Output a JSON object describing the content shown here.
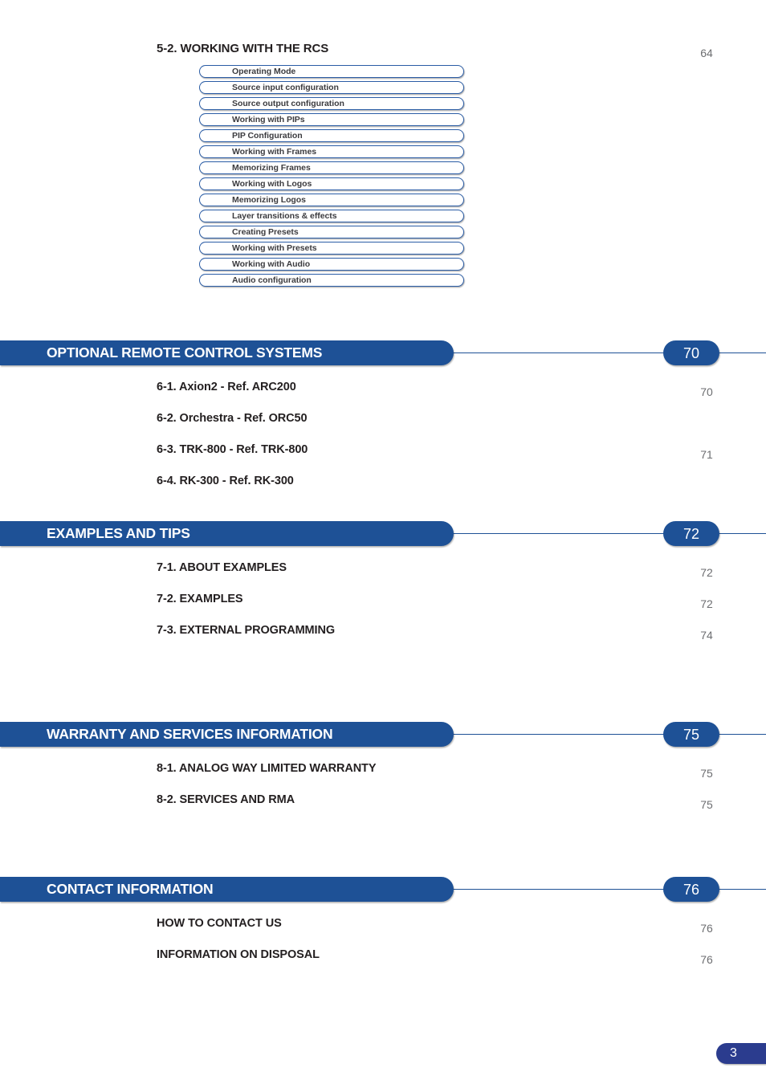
{
  "document": {
    "page_label": "3"
  },
  "top_section": {
    "heading": "5-2. WORKING WITH THE RCS",
    "page": "64",
    "pills": [
      {
        "label": "Operating Mode"
      },
      {
        "label": "Source input configuration"
      },
      {
        "label": "Source output configuration"
      },
      {
        "label": "Working with PIPs"
      },
      {
        "label": "PIP Configuration"
      },
      {
        "label": "Working with Frames"
      },
      {
        "label": "Memorizing Frames"
      },
      {
        "label": "Working with Logos"
      },
      {
        "label": "Memorizing Logos"
      },
      {
        "label": "Layer transitions & effects"
      },
      {
        "label": "Creating Presets"
      },
      {
        "label": "Working with Presets"
      },
      {
        "label": "Working with Audio"
      },
      {
        "label": "Audio configuration"
      }
    ]
  },
  "sections": [
    {
      "title": "OPTIONAL REMOTE CONTROL SYSTEMS",
      "page": "70",
      "entries": [
        {
          "label": "6-1. Axion2 - Ref. ARC200",
          "page": "70"
        },
        {
          "label": "6-2. Orchestra - Ref. ORC50",
          "page": ""
        },
        {
          "label": "6-3. TRK-800 - Ref. TRK-800",
          "page": "71"
        },
        {
          "label": "6-4. RK-300 - Ref. RK-300",
          "page": ""
        }
      ]
    },
    {
      "title": "EXAMPLES AND TIPS",
      "page": "72",
      "entries": [
        {
          "label": "7-1. ABOUT EXAMPLES",
          "page": "72"
        },
        {
          "label": "7-2. EXAMPLES",
          "page": "72"
        },
        {
          "label": "7-3. EXTERNAL PROGRAMMING",
          "page": "74"
        }
      ]
    },
    {
      "title": "WARRANTY AND SERVICES INFORMATION",
      "page": "75",
      "entries": [
        {
          "label": "8-1. ANALOG WAY LIMITED WARRANTY",
          "page": "75"
        },
        {
          "label": "8-2. SERVICES AND RMA",
          "page": "75"
        }
      ]
    },
    {
      "title": "CONTACT INFORMATION",
      "page": "76",
      "entries": [
        {
          "label": "HOW TO CONTACT US",
          "page": "76"
        },
        {
          "label": "INFORMATION ON DISPOSAL",
          "page": "76"
        }
      ]
    }
  ],
  "colors": {
    "accent_blue": "#1e5196",
    "pill_border": "#2a5ca5",
    "footer_blue": "#2b3c8e",
    "page_number_gray": "#6d6e71",
    "text_dark": "#231f20"
  }
}
